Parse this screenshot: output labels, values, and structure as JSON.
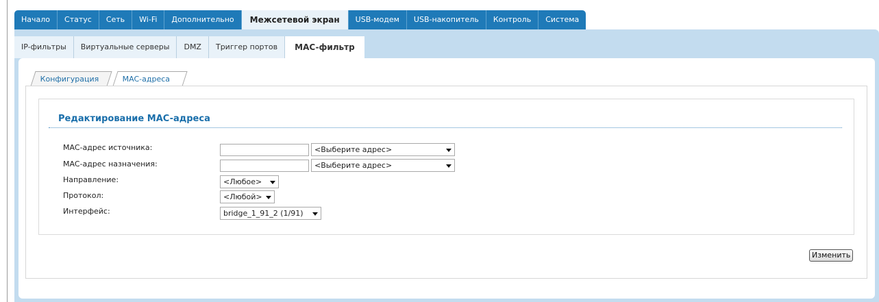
{
  "nav": {
    "tabs": [
      "Начало",
      "Статус",
      "Сеть",
      "Wi-Fi",
      "Дополнительно",
      "Межсетевой экран",
      "USB-модем",
      "USB-накопитель",
      "Контроль",
      "Система"
    ],
    "active": "Межсетевой экран"
  },
  "subnav": {
    "tabs": [
      "IP-фильтры",
      "Виртуальные серверы",
      "DMZ",
      "Триггер портов",
      "MAC-фильтр"
    ],
    "active": "MAC-фильтр"
  },
  "inner_tabs": {
    "config": "Конфигурация",
    "mac": "MAC-адреса"
  },
  "form": {
    "title": "Редактирование MAC-адреса",
    "src_label": "MAC-адрес источника:",
    "src_value": "",
    "src_select": "<Выберите адрес>",
    "dst_label": "MAC-адрес назначения:",
    "dst_value": "",
    "dst_select": "<Выберите адрес>",
    "direction_label": "Направление:",
    "direction_value": "<Любое>",
    "protocol_label": "Протокол:",
    "protocol_value": "<Любой>",
    "interface_label": "Интерфейс:",
    "interface_value": "bridge_1_91_2 (1/91)"
  },
  "buttons": {
    "change": "Изменить"
  },
  "colors": {
    "nav_bg": "#1f7ab8",
    "frame_bg": "#c3dcef",
    "title": "#1a6fab"
  }
}
